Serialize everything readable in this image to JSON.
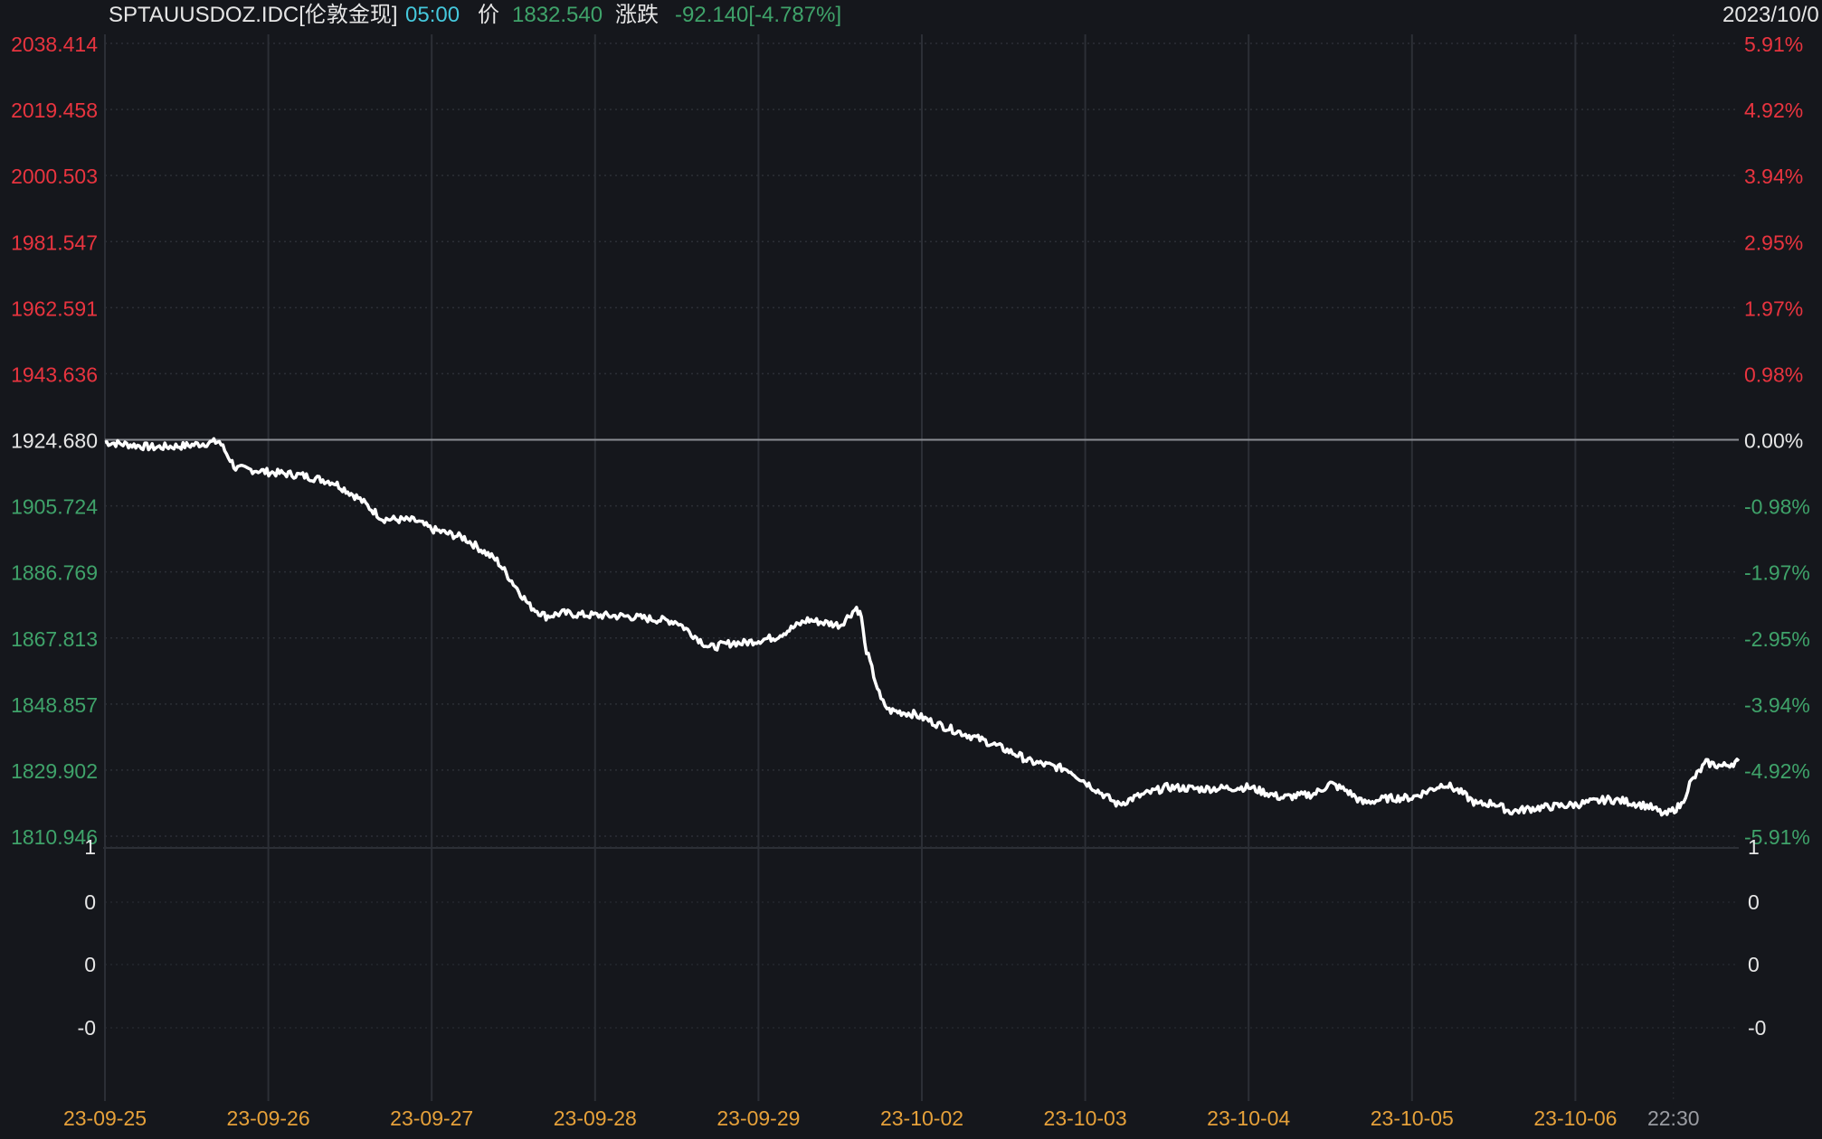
{
  "header": {
    "symbol": "SPTAUUSDOZ.IDC[伦敦金现]",
    "time": "05:00",
    "price_label": "价",
    "price": "1832.540",
    "change_label": "涨跌",
    "change": "-92.140[-4.787%]",
    "date": "2023/10/0"
  },
  "colors": {
    "background": "#15171c",
    "up": "#e8343f",
    "down": "#3fa36a",
    "neutral": "#e6e6e6",
    "line": "#ffffff",
    "time": "#45c8dc",
    "date_axis": "#e6a13a",
    "grid": "#2c2f36"
  },
  "chart_data": {
    "type": "line",
    "title": "SPTAUUSDOZ.IDC[伦敦金现]",
    "x_ticks": [
      "23-09-25",
      "23-09-26",
      "23-09-27",
      "23-09-28",
      "23-09-29",
      "23-10-02",
      "23-10-03",
      "23-10-04",
      "23-10-05",
      "23-10-06",
      "22:30"
    ],
    "y_ticks_price": [
      "2038.414",
      "2019.458",
      "2000.503",
      "1981.547",
      "1962.591",
      "1943.636",
      "1924.680",
      "1905.724",
      "1886.769",
      "1867.813",
      "1848.857",
      "1829.902",
      "1810.946"
    ],
    "y_ticks_pct": [
      "5.91%",
      "4.92%",
      "3.94%",
      "2.95%",
      "1.97%",
      "0.98%",
      "0.00%",
      "-0.98%",
      "-1.97%",
      "-2.95%",
      "-3.94%",
      "-4.92%",
      "-5.91%"
    ],
    "ylim": [
      1810.946,
      2038.414
    ],
    "prev_close": 1924.68,
    "x_range": [
      0,
      10
    ],
    "sub_ticks_left": [
      "1",
      "0",
      "0",
      "-0"
    ],
    "sub_ticks_right": [
      "1",
      "0",
      "0",
      "-0"
    ],
    "grid": true,
    "series": [
      {
        "x": [
          0,
          0.3,
          0.5,
          0.7,
          0.8,
          0.95,
          0.98,
          1.2,
          1.4,
          1.55,
          1.7,
          1.9,
          2.0,
          2.2,
          2.4,
          2.6,
          2.7,
          2.8,
          2.9,
          3.2,
          3.5,
          3.7,
          3.85,
          3.9,
          4.1,
          4.3,
          4.5,
          4.6,
          4.63,
          4.65,
          4.75,
          4.8,
          4.95,
          5.1,
          5.4,
          5.6,
          5.65,
          5.9,
          6.0,
          6.2,
          6.3,
          6.5,
          6.7,
          6.9,
          7.0,
          7.2,
          7.4,
          7.5,
          7.6,
          7.7,
          7.85,
          8.0,
          8.2,
          8.3,
          8.4,
          8.5,
          8.6,
          8.75,
          9.0,
          9.2,
          9.3,
          9.45,
          9.55,
          9.65,
          9.7,
          9.8,
          9.9,
          10.0
        ],
        "y": [
          1924.0,
          1922.5,
          1923.0,
          1924.2,
          1916.5,
          1915.8,
          1915.5,
          1914.5,
          1912.5,
          1908.0,
          1902.0,
          1901.5,
          1899.0,
          1896.5,
          1890.0,
          1877.0,
          1874.0,
          1875.0,
          1874.5,
          1874.0,
          1872.5,
          1865.0,
          1866.5,
          1866.3,
          1868.0,
          1873.0,
          1871.5,
          1876.5,
          1874.0,
          1866.0,
          1850.0,
          1847.0,
          1846.0,
          1843.0,
          1838.0,
          1834.0,
          1832.5,
          1830.0,
          1826.5,
          1820.0,
          1822.0,
          1825.0,
          1824.5,
          1824.8,
          1825.0,
          1822.0,
          1823.0,
          1826.0,
          1824.0,
          1820.5,
          1821.8,
          1822.0,
          1826.0,
          1823.5,
          1820.0,
          1820.5,
          1818.0,
          1819.0,
          1820.0,
          1821.5,
          1821.0,
          1819.5,
          1817.0,
          1820.0,
          1826.0,
          1832.0,
          1831.0,
          1832.5
        ]
      }
    ]
  }
}
